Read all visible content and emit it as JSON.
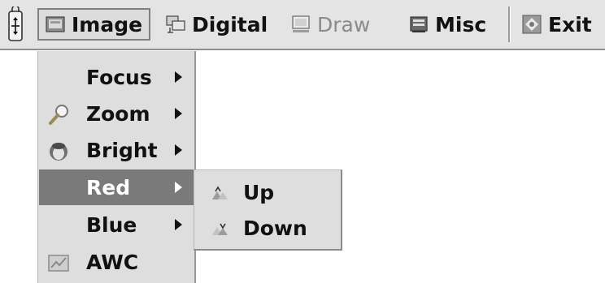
{
  "menubar": {
    "items": [
      {
        "label": "Image",
        "icon": "image-icon",
        "state": "active"
      },
      {
        "label": "Digital",
        "icon": "digital-icon",
        "state": "normal"
      },
      {
        "label": "Draw",
        "icon": "draw-icon",
        "state": "disabled"
      },
      {
        "label": "Misc",
        "icon": "misc-icon",
        "state": "normal"
      },
      {
        "label": "Exit",
        "icon": "exit-icon",
        "state": "normal"
      }
    ]
  },
  "image_menu": {
    "items": [
      {
        "label": "Focus",
        "icon": null,
        "has_submenu": true
      },
      {
        "label": "Zoom",
        "icon": "magnifier-icon",
        "has_submenu": true
      },
      {
        "label": "Bright",
        "icon": "bright-icon",
        "has_submenu": true
      },
      {
        "label": "Red",
        "icon": null,
        "has_submenu": true,
        "selected": true
      },
      {
        "label": "Blue",
        "icon": null,
        "has_submenu": true
      },
      {
        "label": "AWC",
        "icon": "awc-icon",
        "has_submenu": false
      }
    ]
  },
  "red_submenu": {
    "items": [
      {
        "label": "Up",
        "icon": "up-icon"
      },
      {
        "label": "Down",
        "icon": "down-icon"
      }
    ]
  },
  "colors": {
    "menubar_bg": "#e4e4e4",
    "menu_bg": "#dedede",
    "selected_bg": "#7a7a7a",
    "disabled_text": "#8a8a8a"
  }
}
